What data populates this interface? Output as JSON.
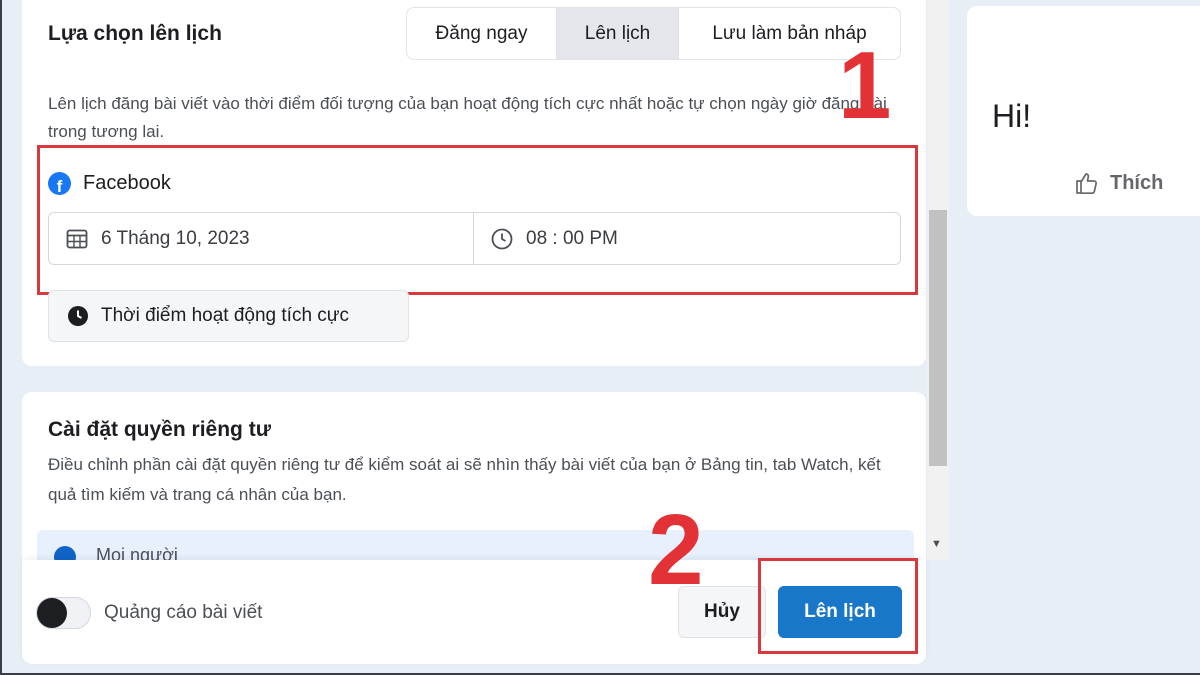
{
  "schedule": {
    "title": "Lựa chọn lên lịch",
    "tabs": [
      {
        "label": "Đăng ngay",
        "active": false
      },
      {
        "label": "Lên lịch",
        "active": true
      },
      {
        "label": "Lưu làm bản nháp",
        "active": false
      }
    ],
    "description": "Lên lịch đăng bài viết vào thời điểm đối tượng của bạn hoạt động tích cực nhất hoặc tự chọn ngày giờ đăng bài trong tương lai.",
    "platform": {
      "label": "Facebook",
      "icon": "facebook-icon",
      "color": "#1877f2"
    },
    "date": {
      "value": "6 Tháng 10, 2023",
      "icon": "calendar-icon"
    },
    "time": {
      "value": "08 : 00 PM",
      "icon": "clock-icon"
    },
    "active_times_label": "Thời điểm hoạt động tích cực"
  },
  "annotations": {
    "step1": "1",
    "step2": "2",
    "color": "#e23235"
  },
  "privacy": {
    "title": "Cài đặt quyền riêng tư",
    "description": "Điều chỉnh phần cài đặt quyền riêng tư để kiểm soát ai sẽ nhìn thấy bài viết của bạn ở Bảng tin, tab Watch, kết quả tìm kiếm và trang cá nhân của bạn.",
    "option_label": "Mọi người"
  },
  "footer": {
    "promote_label": "Quảng cáo bài viết",
    "promote_on": false,
    "cancel_label": "Hủy",
    "schedule_label": "Lên lịch",
    "accent": "#1877c8"
  },
  "preview": {
    "text": "Hi!",
    "like_label": "Thích",
    "like_icon": "thumbs-up-icon"
  }
}
